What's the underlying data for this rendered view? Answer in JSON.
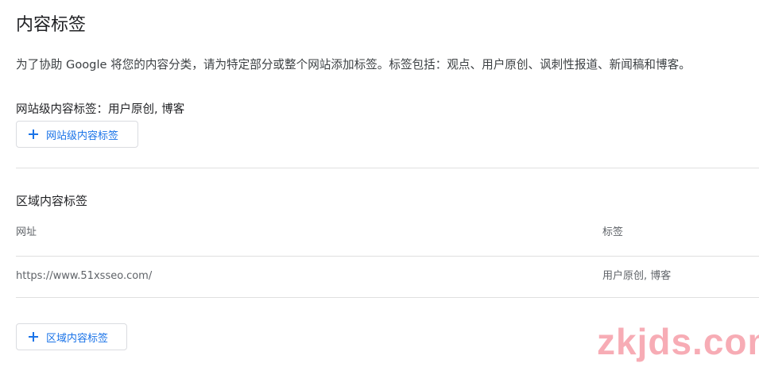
{
  "page": {
    "title": "内容标签",
    "description": "为了协助 Google 将您的内容分类，请为特定部分或整个网站添加标签。标签包括：观点、用户原创、讽刺性报道、新闻稿和博客。"
  },
  "site_level": {
    "label": "网站级内容标签：用户原创, 博客",
    "add_button_label": "网站级内容标签",
    "add_button_icon": "plus-icon"
  },
  "region": {
    "section_title": "区域内容标签",
    "columns": {
      "url": "网址",
      "label": "标签"
    },
    "rows": [
      {
        "url": "https://www.51xsseo.com/",
        "label": "用户原创, 博客"
      }
    ],
    "add_button_label": "区域内容标签",
    "add_button_icon": "plus-icon"
  },
  "watermark": {
    "text": "zkjds.com",
    "color": "#f69ea8"
  },
  "colors": {
    "accent": "#1a73e8",
    "text_primary": "#202124",
    "text_secondary": "#5f6368",
    "divider": "#e0e0e0"
  }
}
